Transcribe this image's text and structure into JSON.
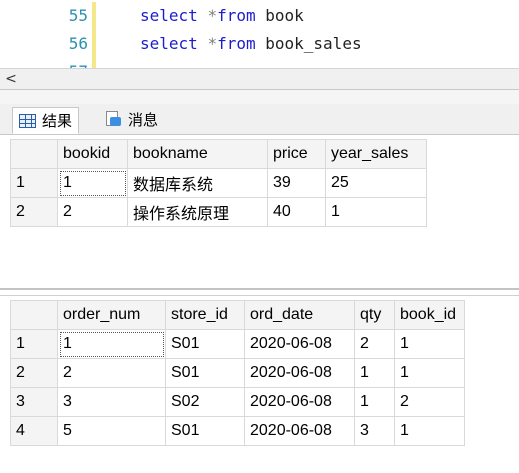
{
  "editor": {
    "lines": [
      {
        "num": "55",
        "kw1": "select",
        "star": "*",
        "kw2": "from",
        "ident": "book"
      },
      {
        "num": "56",
        "kw1": "select",
        "star": "*",
        "kw2": "from",
        "ident": "book_sales"
      },
      {
        "num": "57",
        "kw1": "",
        "star": "",
        "kw2": "",
        "ident": ""
      }
    ]
  },
  "scroll": {
    "left_arrow": "<"
  },
  "tabs": {
    "results_label": "结果",
    "messages_label": "消息"
  },
  "grid1": {
    "columns": [
      "bookid",
      "bookname",
      "price",
      "year_sales"
    ],
    "rows": [
      {
        "n": "1",
        "cells": [
          "1",
          "数据库系统",
          "39",
          "25"
        ]
      },
      {
        "n": "2",
        "cells": [
          "2",
          "操作系统原理",
          "40",
          "1"
        ]
      }
    ]
  },
  "grid2": {
    "columns": [
      "order_num",
      "store_id",
      "ord_date",
      "qty",
      "book_id"
    ],
    "rows": [
      {
        "n": "1",
        "cells": [
          "1",
          "S01",
          "2020-06-08",
          "2",
          "1"
        ]
      },
      {
        "n": "2",
        "cells": [
          "2",
          "S01",
          "2020-06-08",
          "1",
          "1"
        ]
      },
      {
        "n": "3",
        "cells": [
          "3",
          "S02",
          "2020-06-08",
          "1",
          "2"
        ]
      },
      {
        "n": "4",
        "cells": [
          "5",
          "S01",
          "2020-06-08",
          "3",
          "1"
        ]
      }
    ]
  }
}
